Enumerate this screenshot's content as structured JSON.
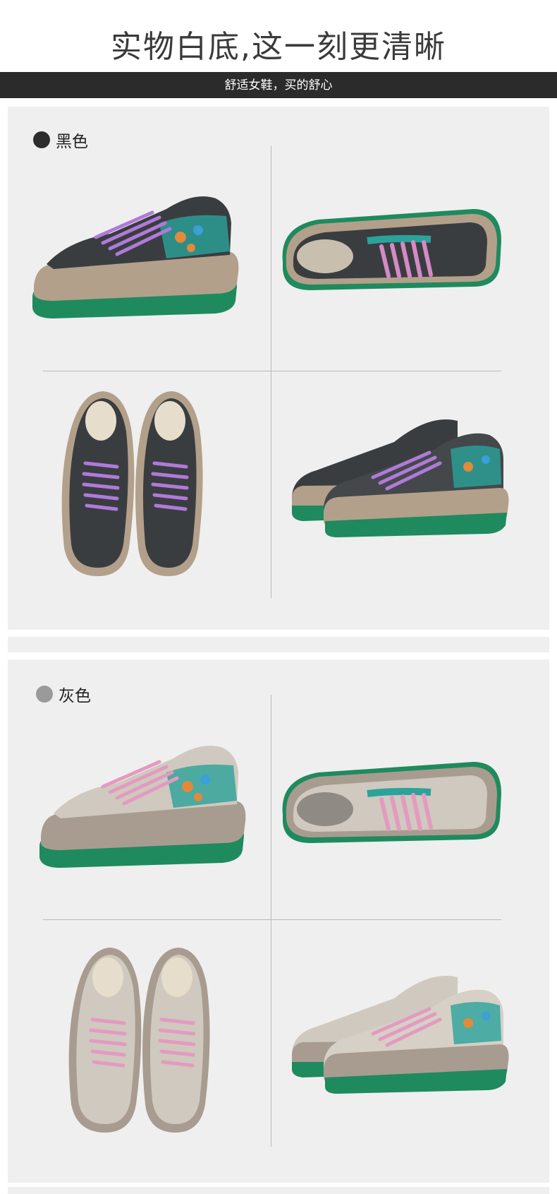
{
  "header": {
    "title": "实物白底,这一刻更清晰",
    "subtitle": "舒适女鞋，买的舒心"
  },
  "sections": [
    {
      "label": "黑色",
      "dot_color": "#2d2d2d",
      "upper_color": "#3a3d40",
      "midsole_color": "#b3a08a",
      "outsole_color": "#1f8a5e",
      "lace_color": "#b07ad9"
    },
    {
      "label": "灰色",
      "dot_color": "#9a9a9a",
      "upper_color": "#cfc9bf",
      "midsole_color": "#a89c90",
      "outsole_color": "#1f8a5e",
      "lace_color": "#e49ac0"
    }
  ]
}
